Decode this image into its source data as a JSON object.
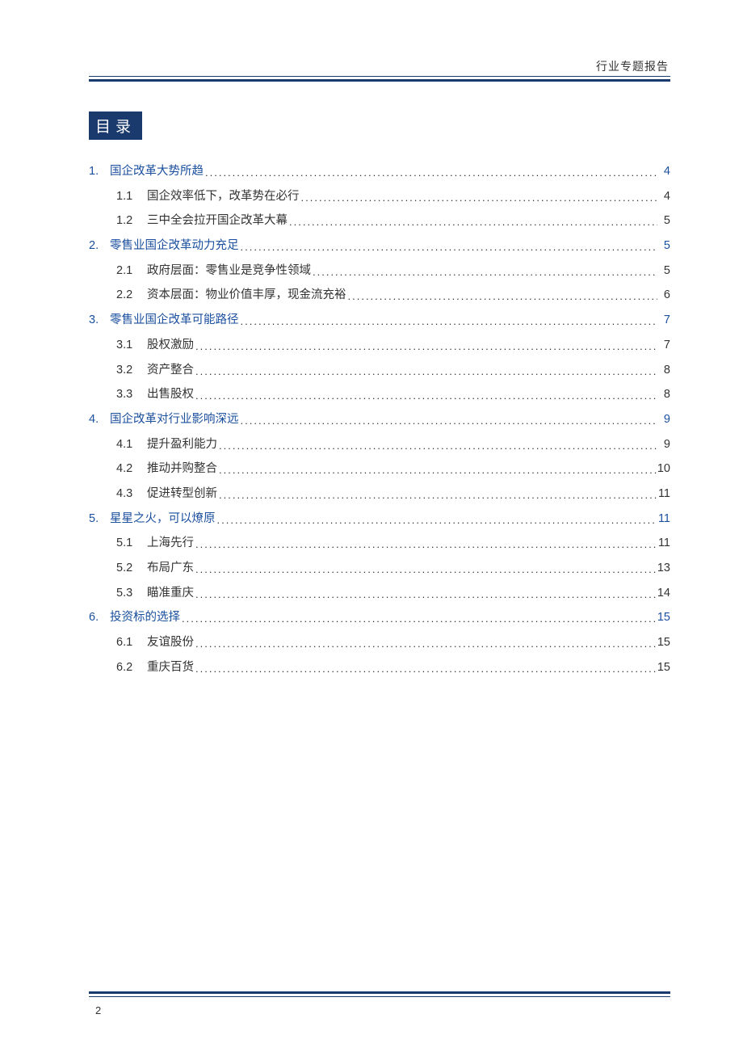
{
  "header": {
    "doc_type": "行业专题报告"
  },
  "toc_title": "目录",
  "toc": [
    {
      "level": 1,
      "num": "1.",
      "title": "国企改革大势所趋",
      "page": "4"
    },
    {
      "level": 2,
      "num": "1.1",
      "title": "国企效率低下，改革势在必行",
      "page": "4"
    },
    {
      "level": 2,
      "num": "1.2",
      "title": "三中全会拉开国企改革大幕",
      "page": "5"
    },
    {
      "level": 1,
      "num": "2.",
      "title": "零售业国企改革动力充足",
      "page": "5"
    },
    {
      "level": 2,
      "num": "2.1",
      "title": "政府层面：零售业是竞争性领域",
      "page": "5"
    },
    {
      "level": 2,
      "num": "2.2",
      "title": "资本层面：物业价值丰厚，现金流充裕",
      "page": "6"
    },
    {
      "level": 1,
      "num": "3.",
      "title": "零售业国企改革可能路径",
      "page": "7"
    },
    {
      "level": 2,
      "num": "3.1",
      "title": "股权激励",
      "page": "7"
    },
    {
      "level": 2,
      "num": "3.2",
      "title": "资产整合",
      "page": "8"
    },
    {
      "level": 2,
      "num": "3.3",
      "title": "出售股权",
      "page": "8"
    },
    {
      "level": 1,
      "num": "4.",
      "title": "国企改革对行业影响深远",
      "page": "9"
    },
    {
      "level": 2,
      "num": "4.1",
      "title": "提升盈利能力",
      "page": "9"
    },
    {
      "level": 2,
      "num": "4.2",
      "title": "推动并购整合",
      "page": "10"
    },
    {
      "level": 2,
      "num": "4.3",
      "title": "促进转型创新",
      "page": "11"
    },
    {
      "level": 1,
      "num": "5.",
      "title": "星星之火，可以燎原",
      "page": "11"
    },
    {
      "level": 2,
      "num": "5.1",
      "title": "上海先行",
      "page": "11"
    },
    {
      "level": 2,
      "num": "5.2",
      "title": "布局广东",
      "page": "13"
    },
    {
      "level": 2,
      "num": "5.3",
      "title": "瞄准重庆",
      "page": "14"
    },
    {
      "level": 1,
      "num": "6.",
      "title": "投资标的选择",
      "page": "15"
    },
    {
      "level": 2,
      "num": "6.1",
      "title": "友谊股份",
      "page": "15"
    },
    {
      "level": 2,
      "num": "6.2",
      "title": "重庆百货",
      "page": "15"
    }
  ],
  "footer": {
    "page_number": "2"
  }
}
